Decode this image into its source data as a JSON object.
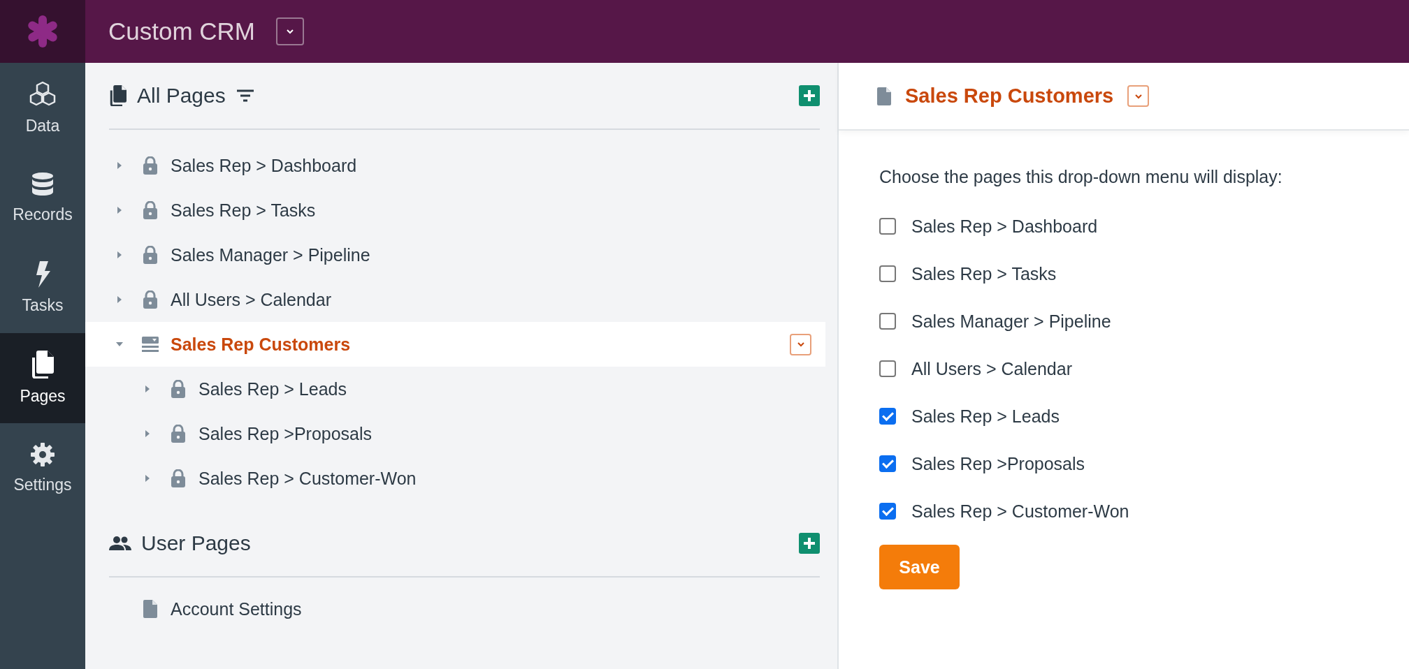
{
  "app": {
    "title": "Custom CRM"
  },
  "nav": [
    {
      "label": "Data",
      "selected": false
    },
    {
      "label": "Records",
      "selected": false
    },
    {
      "label": "Tasks",
      "selected": false
    },
    {
      "label": "Pages",
      "selected": true
    },
    {
      "label": "Settings",
      "selected": false
    }
  ],
  "all_pages": {
    "title": "All Pages",
    "items": [
      {
        "kind": "locked",
        "label": "Sales Rep > Dashboard",
        "expanded": false,
        "selected": false
      },
      {
        "kind": "locked",
        "label": "Sales Rep > Tasks",
        "expanded": false,
        "selected": false
      },
      {
        "kind": "locked",
        "label": "Sales Manager > Pipeline",
        "expanded": false,
        "selected": false
      },
      {
        "kind": "locked",
        "label": "All Users > Calendar",
        "expanded": false,
        "selected": false
      },
      {
        "kind": "menu",
        "label": "Sales Rep Customers",
        "expanded": true,
        "selected": true,
        "children": [
          {
            "kind": "locked",
            "label": "Sales Rep > Leads",
            "expanded": false,
            "selected": false
          },
          {
            "kind": "locked",
            "label": "Sales Rep >Proposals",
            "expanded": false,
            "selected": false
          },
          {
            "kind": "locked",
            "label": "Sales Rep > Customer-Won",
            "expanded": false,
            "selected": false
          }
        ]
      }
    ]
  },
  "user_pages": {
    "title": "User Pages",
    "items": [
      {
        "kind": "page",
        "label": "Account Settings",
        "selected": false
      }
    ]
  },
  "detail": {
    "title": "Sales Rep Customers",
    "intro": "Choose the pages this drop-down menu will display:",
    "options": [
      {
        "label": "Sales Rep > Dashboard",
        "checked": false
      },
      {
        "label": "Sales Rep > Tasks",
        "checked": false
      },
      {
        "label": "Sales Manager > Pipeline",
        "checked": false
      },
      {
        "label": "All Users > Calendar",
        "checked": false
      },
      {
        "label": "Sales Rep > Leads",
        "checked": true
      },
      {
        "label": "Sales Rep >Proposals",
        "checked": true
      },
      {
        "label": "Sales Rep > Customer-Won",
        "checked": true
      }
    ],
    "save_button": "Save"
  }
}
